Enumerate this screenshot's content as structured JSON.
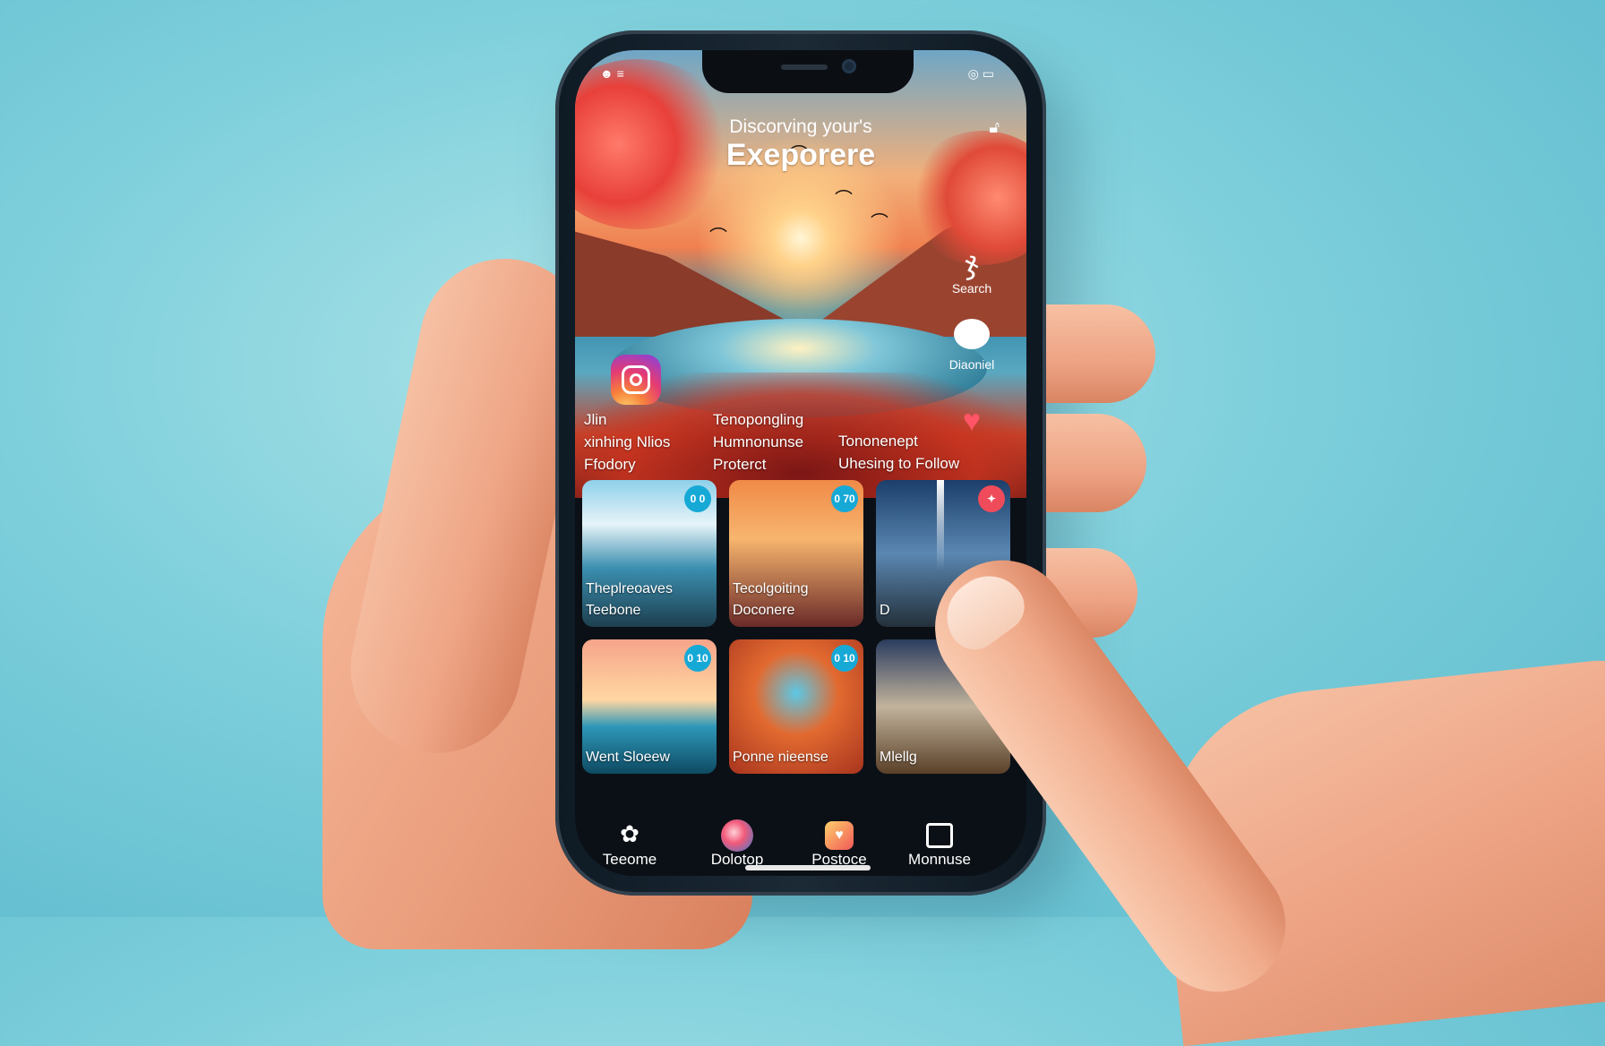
{
  "status": {
    "left": "☻ ≡",
    "right": "◎ ▭"
  },
  "hero": {
    "subtitle": "Discorving your's",
    "title": "Exeporere",
    "lock_icon": "lock-icon"
  },
  "side_actions": [
    {
      "icon": "knot-icon",
      "label": "Search"
    },
    {
      "icon": "chat-bubble-icon",
      "label": "Diaoniel"
    },
    {
      "icon": "heart-icon",
      "label": ""
    }
  ],
  "captions": [
    {
      "lines": [
        "Jlin",
        "xinhing Nlios",
        "Ffodory"
      ]
    },
    {
      "lines": [
        "Tenopongling",
        "Humnonunse",
        "Proterct"
      ]
    },
    {
      "lines": [
        "Tononenept",
        "Uhesing to Follow"
      ]
    }
  ],
  "grid": [
    {
      "badge": "0 0",
      "lines": [
        "Theplreoaves",
        "Teebone"
      ]
    },
    {
      "badge": "0 70",
      "lines": [
        "Tecolgoiting",
        "Doconere"
      ]
    },
    {
      "badge": "",
      "lines": [
        "D"
      ]
    },
    {
      "badge": "0 10",
      "lines": [
        "Went Sloeew"
      ]
    },
    {
      "badge": "0 10",
      "lines": [
        "Ponne nieense"
      ]
    },
    {
      "badge": "",
      "lines": [
        "Mlellg"
      ]
    }
  ],
  "bottom_nav": [
    {
      "icon": "pinwheel-icon",
      "label": "Teeome"
    },
    {
      "icon": "circle-app-icon",
      "label": "Dolotop"
    },
    {
      "icon": "heart-app-icon",
      "label": "Postoce"
    },
    {
      "icon": "box-icon",
      "label": "Monnuse"
    }
  ],
  "colors": {
    "accent": "#17a9d6",
    "alert": "#ef4b5b",
    "background": "#7fd0dc"
  }
}
